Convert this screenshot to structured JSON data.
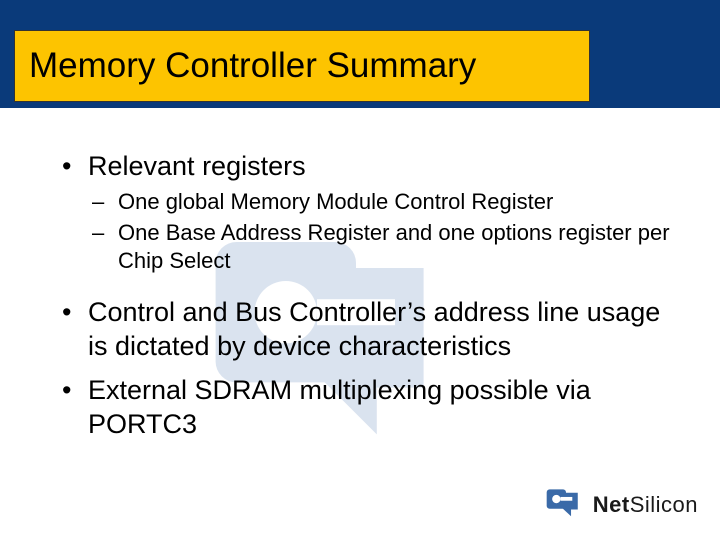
{
  "brand": {
    "name": "NetSilicon",
    "display_bold": "Net",
    "display_light": "Silicon",
    "accent_color": "#3a6aa8",
    "title_bg": "#fdc400",
    "band_color": "#0a3a7a"
  },
  "title": "Memory Controller Summary",
  "bullets": [
    {
      "level": 1,
      "text": "Relevant registers",
      "children": [
        {
          "level": 2,
          "text": "One global Memory Module Control Register"
        },
        {
          "level": 2,
          "text": "One Base Address Register and one options register per Chip Select"
        }
      ]
    },
    {
      "level": 1,
      "text": "Control and Bus Controller’s address line usage is dictated by device characteristics"
    },
    {
      "level": 1,
      "text": "External SDRAM multiplexing possible via PORTC3"
    }
  ]
}
